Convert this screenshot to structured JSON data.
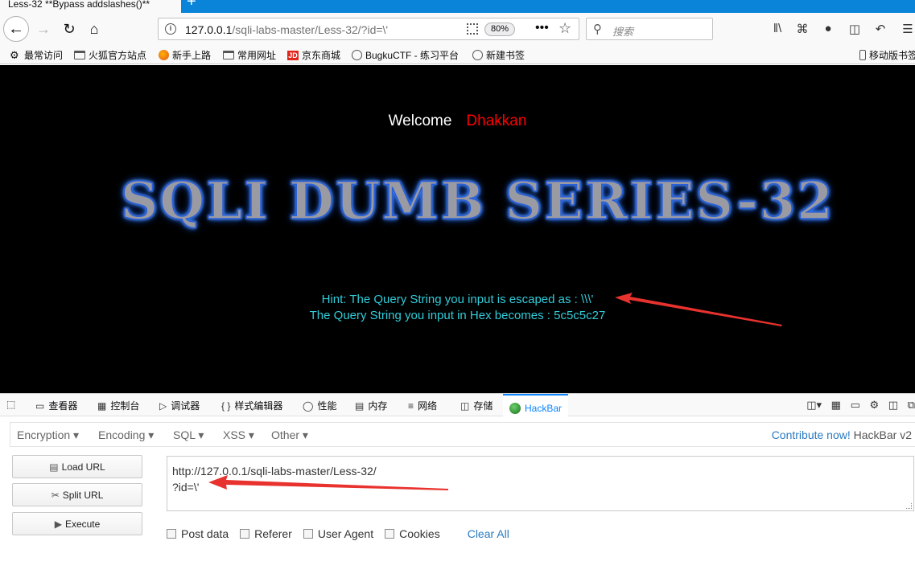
{
  "browser": {
    "tab_title": "Less-32 **Bypass addslashes()**",
    "new_tab": "+",
    "url_host": "127.0.0.1",
    "url_path": "/sqli-labs-master/Less-32/?id=\\'",
    "zoom": "80%",
    "search_placeholder": "搜索",
    "bookmarks": [
      {
        "label": "最常访问",
        "icon": "gear-icon"
      },
      {
        "label": "火狐官方站点",
        "icon": "folder-icon"
      },
      {
        "label": "新手上路",
        "icon": "firefox-icon"
      },
      {
        "label": "常用网址",
        "icon": "folder-icon"
      },
      {
        "label": "京东商城",
        "icon": "jd-icon"
      },
      {
        "label": "BugkuCTF - 练习平台",
        "icon": "globe-icon"
      },
      {
        "label": "新建书签",
        "icon": "globe-icon"
      }
    ],
    "mobile_bookmarks": "移动版书签"
  },
  "page": {
    "welcome": "Welcome",
    "welcome_name": "Dhakkan",
    "banner": "SQLI DUMB SERIES-32",
    "hint_line1": "Hint: The Query String you input is escaped as : \\\\\\'",
    "hint_line2": "The Query String you input in Hex becomes : 5c5c5c27"
  },
  "devtools": {
    "tabs": [
      {
        "label": "查看器"
      },
      {
        "label": "控制台"
      },
      {
        "label": "调试器"
      },
      {
        "label": "样式编辑器"
      },
      {
        "label": "性能"
      },
      {
        "label": "内存"
      },
      {
        "label": "网络"
      },
      {
        "label": "存储"
      },
      {
        "label": "HackBar"
      }
    ]
  },
  "hackbar": {
    "menus": [
      "Encryption",
      "Encoding",
      "SQL",
      "XSS",
      "Other"
    ],
    "contribute_link": "Contribute now!",
    "version": "HackBar v2",
    "load_url": "Load URL",
    "split_url": "Split URL",
    "execute": "Execute",
    "url_text": "http://127.0.0.1/sqli-labs-master/Less-32/\n?id=\\'",
    "checkboxes": [
      "Post data",
      "Referer",
      "User Agent",
      "Cookies"
    ],
    "clear_all": "Clear All"
  },
  "colors": {
    "welcome_name": "#ff0000",
    "hint": "#31ccd9",
    "arrow": "#e8322e",
    "active_tab": "#0a84ff",
    "link": "#2a7ac0"
  }
}
